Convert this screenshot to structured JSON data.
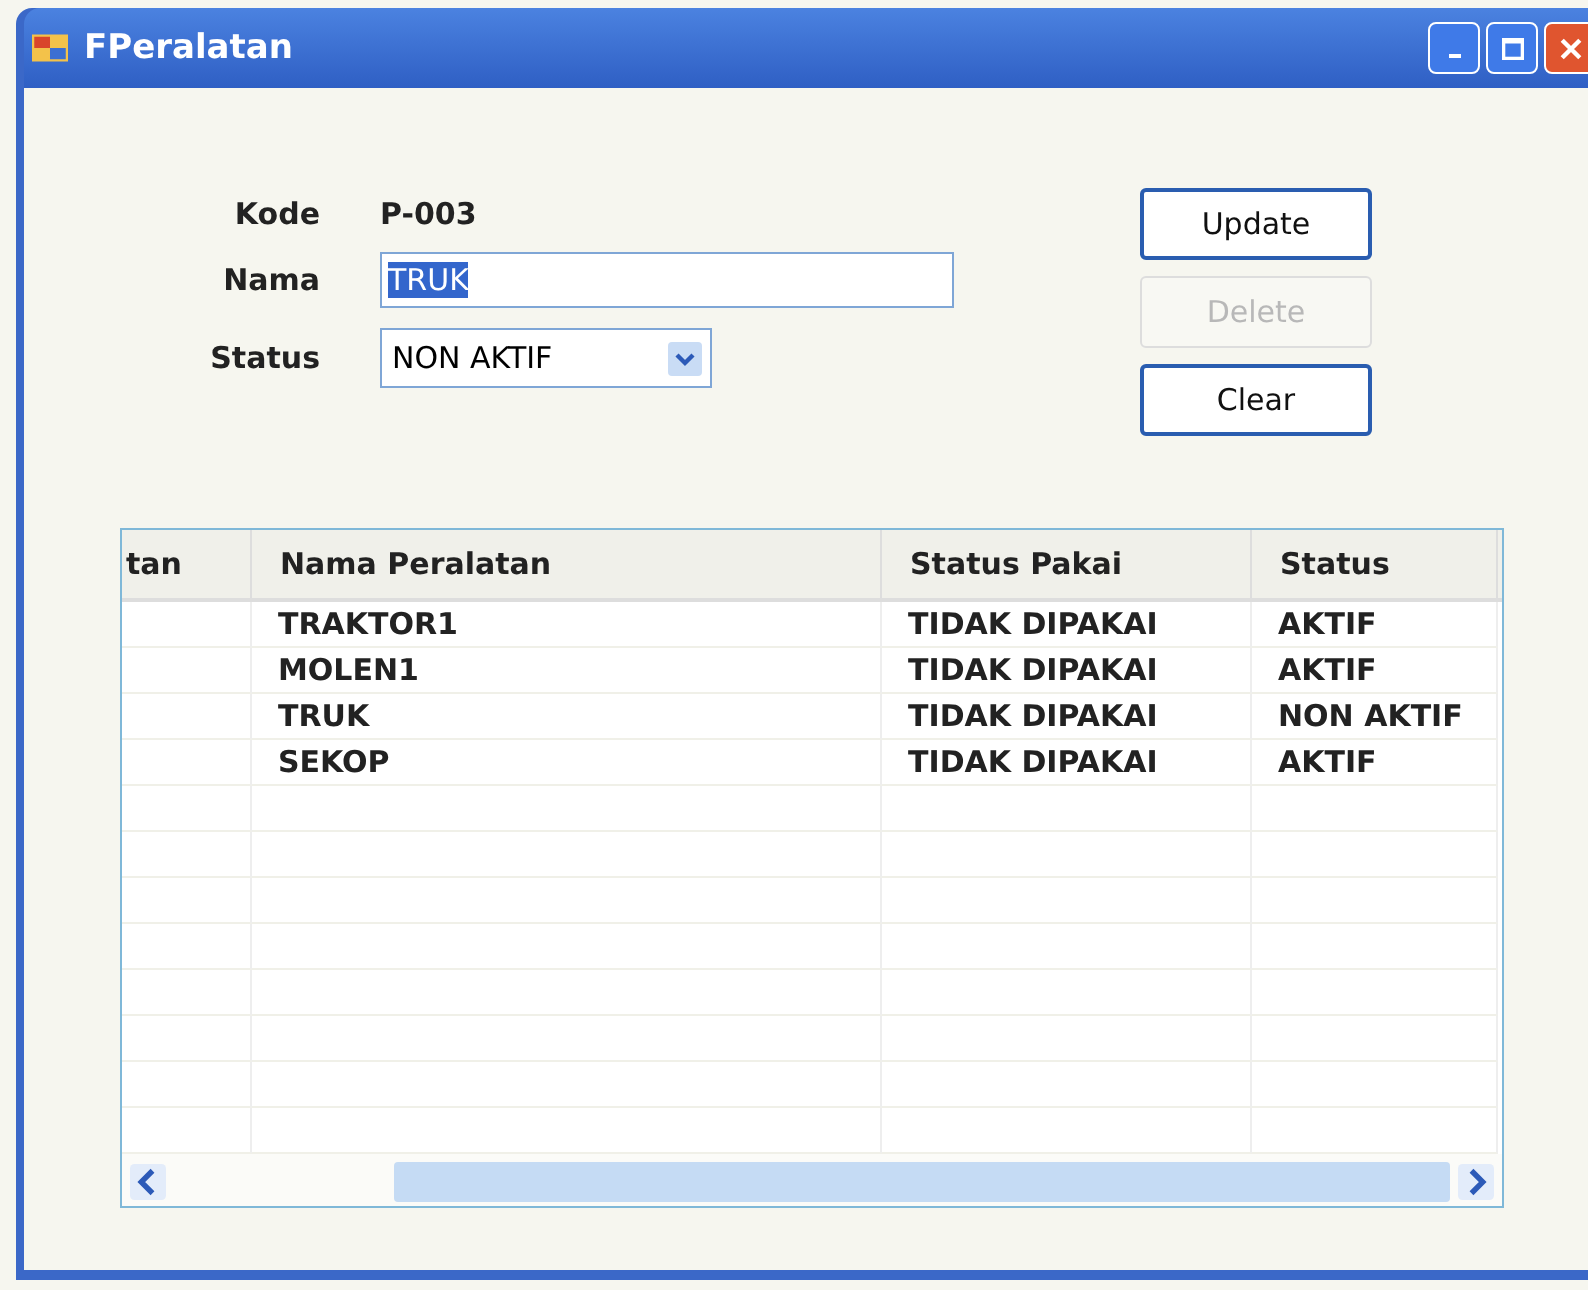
{
  "window": {
    "title": "FPeralatan"
  },
  "form": {
    "fields": [
      {
        "kind": "text",
        "label": "Kode",
        "value": "P-003"
      },
      {
        "kind": "input",
        "label": "Nama",
        "value": "TRUK",
        "highlighted": true
      },
      {
        "kind": "combo",
        "label": "Status",
        "value": "NON AKTIF"
      }
    ]
  },
  "buttons": [
    {
      "label": "Update",
      "disabled": false
    },
    {
      "label": "Delete",
      "disabled": true
    },
    {
      "label": "Clear",
      "disabled": false
    }
  ],
  "table": {
    "columns": [
      "tan",
      "Nama Peralatan",
      "Status Pakai",
      "Status"
    ],
    "rows": [
      [
        "",
        "TRAKTOR1",
        "TIDAK DIPAKAI",
        "AKTIF"
      ],
      [
        "",
        "MOLEN1",
        "TIDAK DIPAKAI",
        "AKTIF"
      ],
      [
        "",
        "TRUK",
        "TIDAK DIPAKAI",
        "NON AKTIF"
      ],
      [
        "",
        "SEKOP",
        "TIDAK DIPAKAI",
        "AKTIF"
      ]
    ]
  }
}
